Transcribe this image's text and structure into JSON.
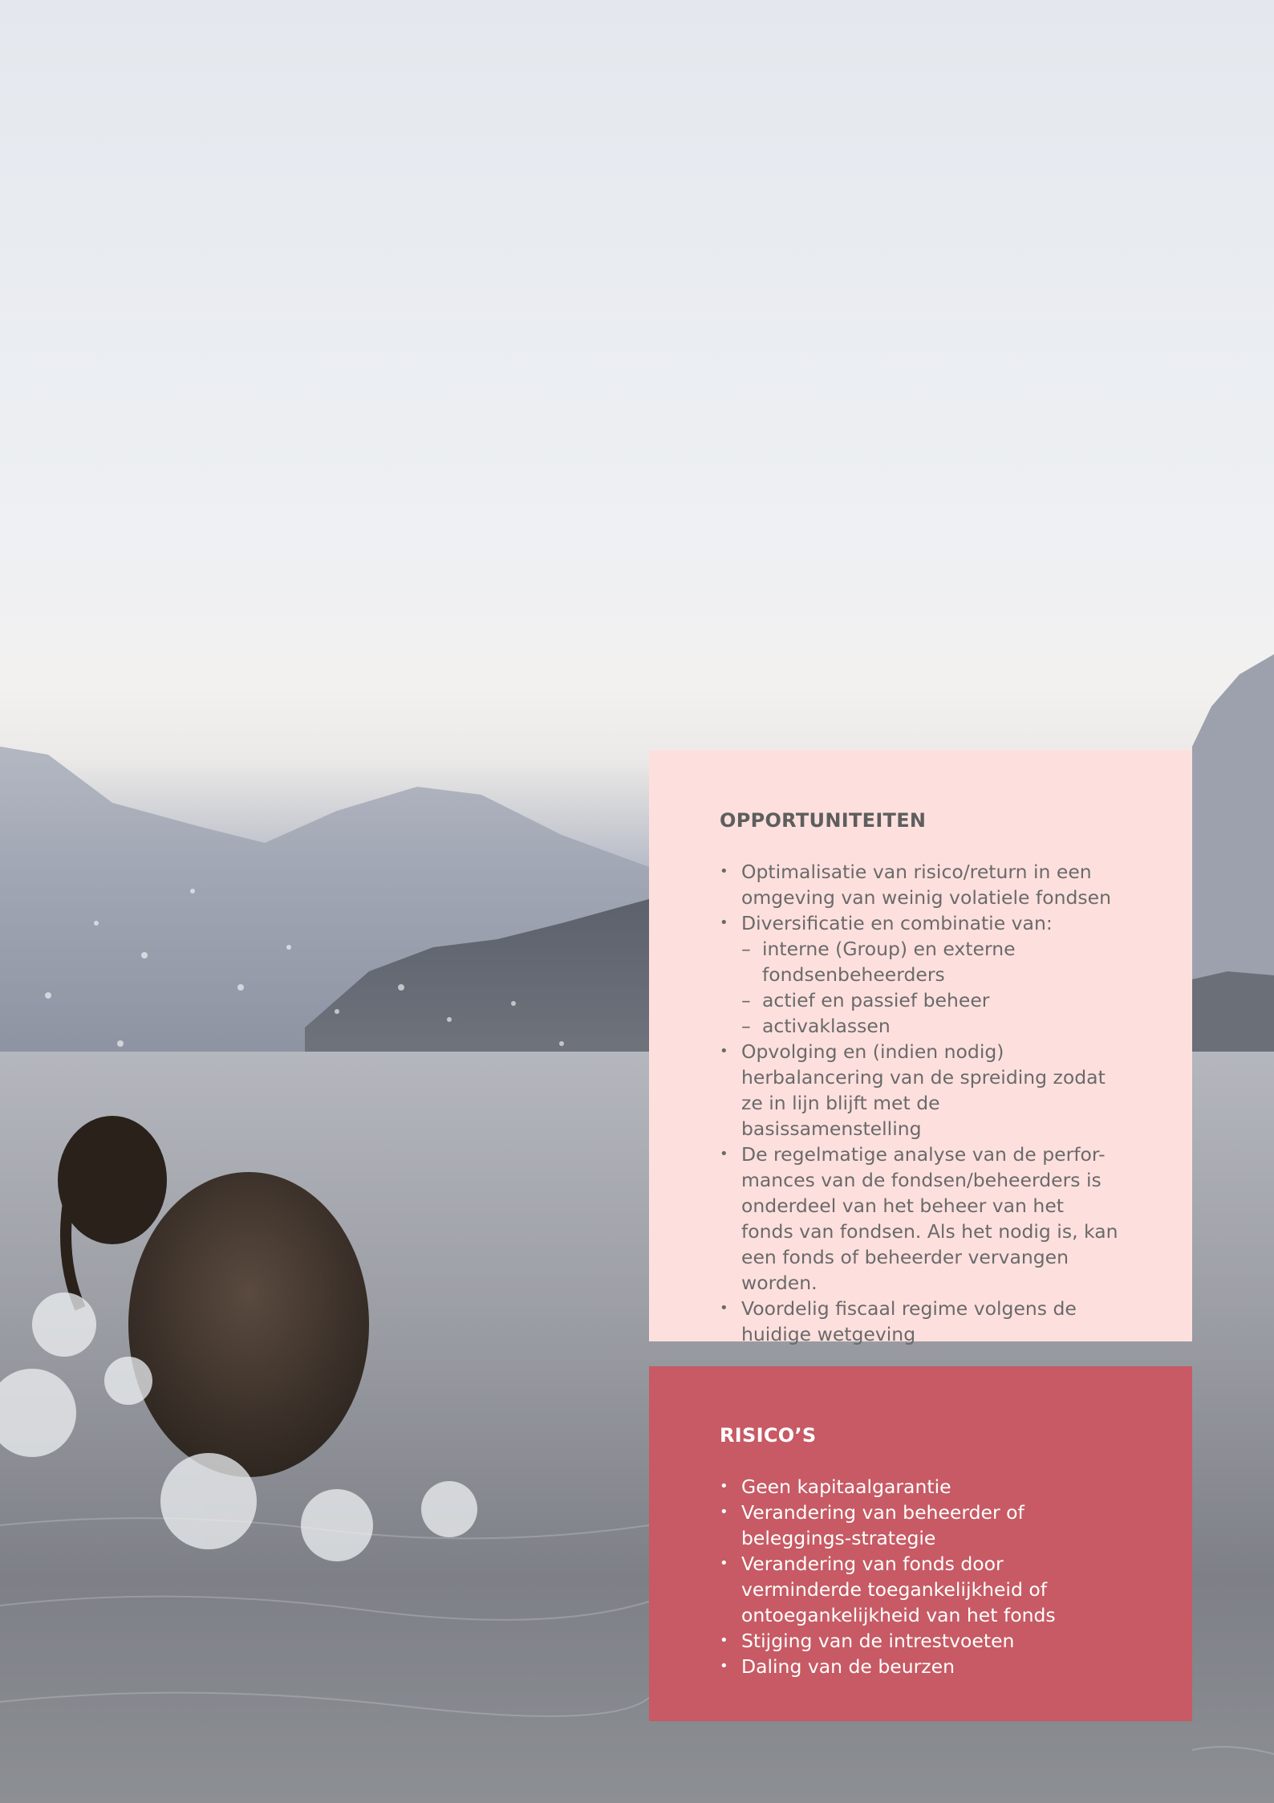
{
  "colors": {
    "opportunities_background": "#fde0de",
    "risks_background": "#c75a64",
    "opportunities_text": "#6a6a6a",
    "risks_text": "#ffffff"
  },
  "opportunities": {
    "title": "OPPORTUNITEITEN",
    "items": [
      {
        "text": "Optimalisatie van risico/return in een omgeving van weinig volatiele fondsen"
      },
      {
        "text": "Diversificatie en combinatie van:",
        "sub": [
          "interne (Group) en externe fondsenbeheerders",
          "actief en passief beheer",
          "activaklassen"
        ]
      },
      {
        "text": "Opvolging en (indien nodig) herbalancering van de spreiding zodat ze in lijn blijft met de basissamenstelling"
      },
      {
        "text": "De regelmatige analyse van de perfor-mances van de fondsen/beheerders is onderdeel van het beheer van het fonds van fondsen. Als het nodig is, kan een fonds of beheerder vervangen worden."
      },
      {
        "text": "Voordelig fiscaal regime volgens de huidige wetgeving"
      }
    ]
  },
  "risks": {
    "title": "RISICO’S",
    "items": [
      "Geen kapitaalgarantie",
      "Verandering van beheerder of beleggings-strategie",
      "Verandering van fonds door verminderde toegankelijkheid of ontoegankelijkheid van het fonds",
      "Stijging van de intrestvoeten",
      "Daling van de beurzen"
    ]
  }
}
